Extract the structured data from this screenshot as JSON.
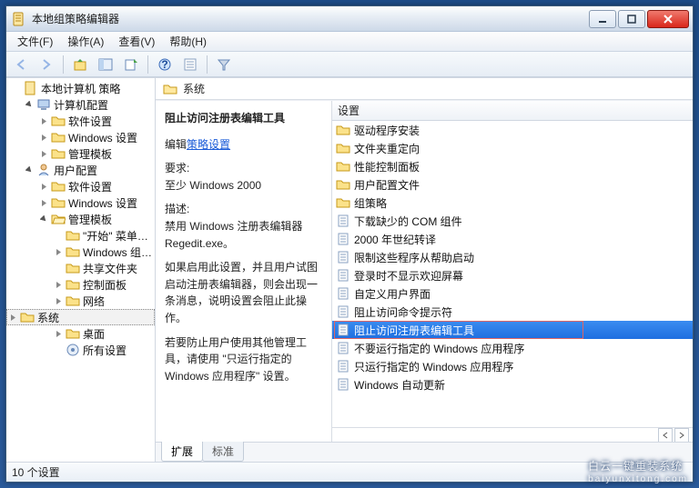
{
  "window": {
    "title": "本地组策略编辑器"
  },
  "menu": {
    "file": "文件(F)",
    "action": "操作(A)",
    "view": "查看(V)",
    "help": "帮助(H)"
  },
  "tree": {
    "root": "本地计算机 策略",
    "computer": "计算机配置",
    "c_soft": "软件设置",
    "c_win": "Windows 设置",
    "c_adm": "管理模板",
    "user": "用户配置",
    "u_soft": "软件设置",
    "u_win": "Windows 设置",
    "u_adm": "管理模板",
    "u_start": "\"开始\" 菜单…",
    "u_wincomp": "Windows 组…",
    "u_shared": "共享文件夹",
    "u_cpl": "控制面板",
    "u_net": "网络",
    "u_sys": "系统",
    "u_desk": "桌面",
    "u_all": "所有设置"
  },
  "header": {
    "folder": "系统"
  },
  "detail": {
    "title": "阻止访问注册表编辑工具",
    "edit_prefix": "编辑",
    "edit_link": "策略设置",
    "req_label": "要求:",
    "req_text": "至少 Windows 2000",
    "desc_label": "描述:",
    "desc_1": "禁用 Windows 注册表编辑器 Regedit.exe。",
    "desc_2": "如果启用此设置，并且用户试图启动注册表编辑器，则会出现一条消息，说明设置会阻止此操作。",
    "desc_3": "若要防止用户使用其他管理工具，请使用 \"只运行指定的 Windows 应用程序\" 设置。"
  },
  "column": {
    "setting": "设置"
  },
  "items": [
    {
      "t": "folder",
      "label": "驱动程序安装"
    },
    {
      "t": "folder",
      "label": "文件夹重定向"
    },
    {
      "t": "folder",
      "label": "性能控制面板"
    },
    {
      "t": "folder",
      "label": "用户配置文件"
    },
    {
      "t": "folder",
      "label": "组策略"
    },
    {
      "t": "policy",
      "label": "下载缺少的 COM 组件"
    },
    {
      "t": "policy",
      "label": "2000 年世纪转译"
    },
    {
      "t": "policy",
      "label": "限制这些程序从帮助启动"
    },
    {
      "t": "policy",
      "label": "登录时不显示欢迎屏幕"
    },
    {
      "t": "policy",
      "label": "自定义用户界面"
    },
    {
      "t": "policy",
      "label": "阻止访问命令提示符"
    },
    {
      "t": "policy",
      "label": "阻止访问注册表编辑工具",
      "selected": true
    },
    {
      "t": "policy",
      "label": "不要运行指定的 Windows 应用程序"
    },
    {
      "t": "policy",
      "label": "只运行指定的 Windows 应用程序"
    },
    {
      "t": "policy",
      "label": "Windows 自动更新"
    }
  ],
  "tabs": {
    "ext": "扩展",
    "std": "标准"
  },
  "status": {
    "text": "10 个设置"
  },
  "watermark": {
    "cn": "白云一键重装系统",
    "en": "baiyunxitong.com"
  }
}
